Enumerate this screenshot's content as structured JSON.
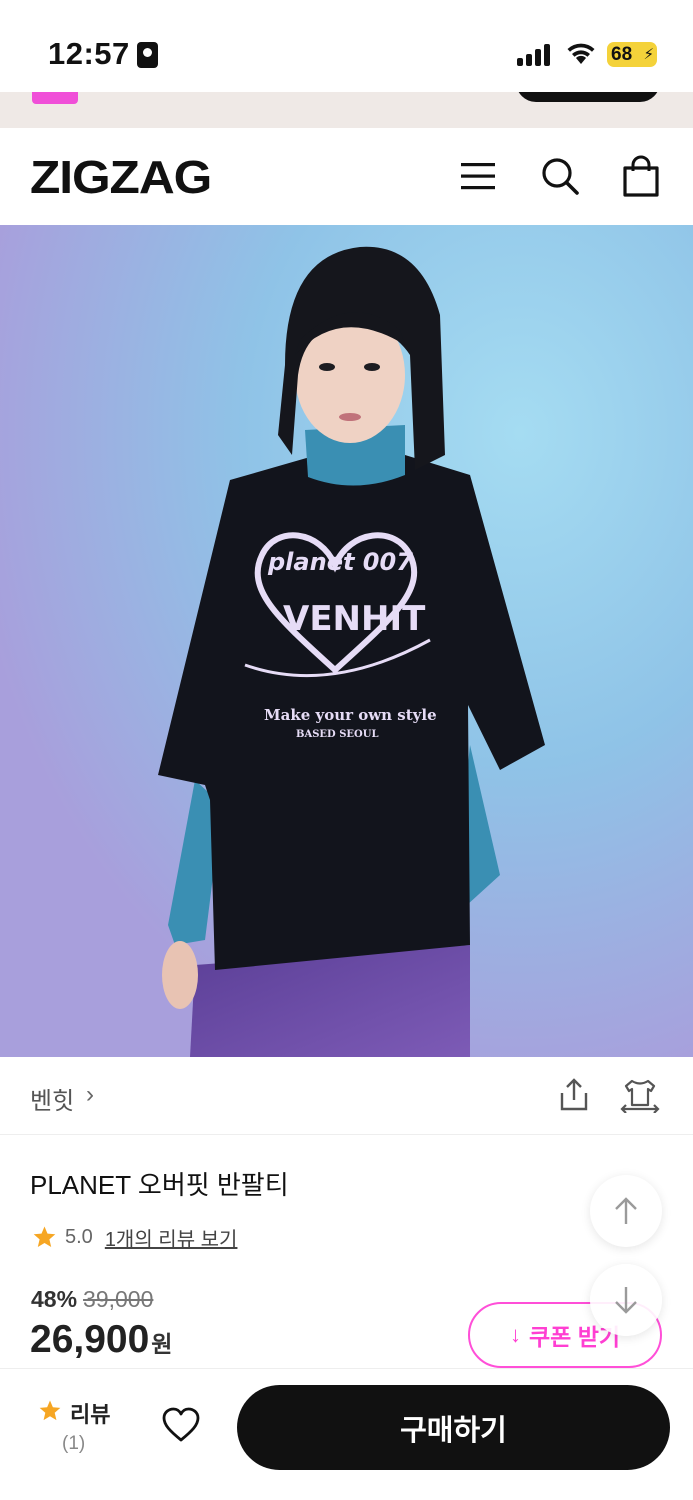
{
  "status_bar": {
    "time": "12:57",
    "battery": "68"
  },
  "header": {
    "logo": "ZIGZAG",
    "icons": [
      "menu-icon",
      "search-icon",
      "shopping-bag-icon"
    ]
  },
  "product": {
    "image_alt_colors": {
      "background": "#8ec3e6",
      "tee": "#111111",
      "turtleneck": "#3a8fb3",
      "jeans": "#6a4fa0"
    },
    "tee_graphic_text": [
      "planet 007",
      "VENHIT",
      "Make your own style",
      "BASED SEOUL"
    ],
    "brand": "벤힛",
    "brand_chevron": "›",
    "title": "PLANET 오버핏 반팔티",
    "rating": "5.0",
    "review_link": "1개의 리뷰 보기",
    "discount": "48%",
    "original_price": "39,000",
    "price": "26,900",
    "currency": "원",
    "coupon_label": "쿠폰 받기"
  },
  "bottom_bar": {
    "review_label": "리뷰",
    "review_count": "(1)",
    "buy_label": "구매하기"
  },
  "colors": {
    "accent_pink": "#ff3fd2",
    "star": "#f6a623",
    "black": "#111111"
  }
}
